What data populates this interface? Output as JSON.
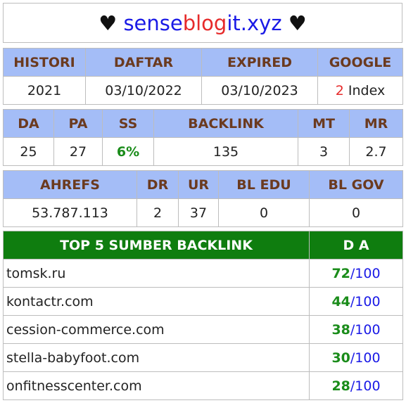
{
  "title": {
    "heart": "♥",
    "part1": "sense",
    "part2": "blog",
    "part3": "it.xyz"
  },
  "table1": {
    "headers": [
      "HISTORI",
      "DAFTAR",
      "EXPIRED",
      "GOOGLE"
    ],
    "row": [
      "2021",
      "03/10/2022",
      "03/10/2023"
    ],
    "google_count": "2",
    "google_label": "Index"
  },
  "table2": {
    "headers": [
      "DA",
      "PA",
      "SS",
      "BACKLINK",
      "MT",
      "MR"
    ],
    "row": [
      "25",
      "27",
      "6%",
      "135",
      "3",
      "2.7"
    ]
  },
  "table3": {
    "headers": [
      "AHREFS",
      "DR",
      "UR",
      "BL EDU",
      "BL GOV"
    ],
    "row": [
      "53.787.113",
      "2",
      "37",
      "0",
      "0"
    ]
  },
  "table4": {
    "headers": [
      "TOP 5 SUMBER BACKLINK",
      "D A"
    ],
    "separator": "/",
    "max": "100",
    "rows": [
      {
        "site": "tomsk.ru",
        "da": "72"
      },
      {
        "site": "kontactr.com",
        "da": "44"
      },
      {
        "site": "cession-commerce.com",
        "da": "38"
      },
      {
        "site": "stella-babyfoot.com",
        "da": "30"
      },
      {
        "site": "onfitnesscenter.com",
        "da": "28"
      }
    ]
  }
}
